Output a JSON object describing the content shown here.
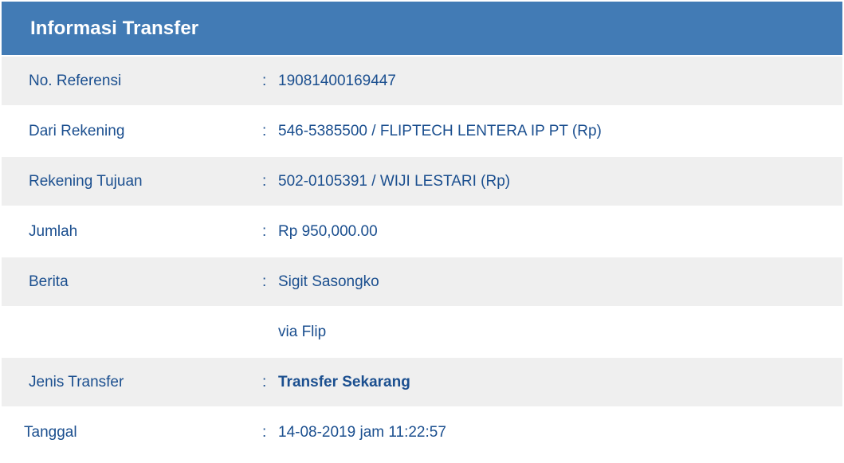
{
  "header": {
    "title": "Informasi Transfer"
  },
  "separator": ":",
  "rows": [
    {
      "label": "No. Referensi",
      "value": "19081400169447"
    },
    {
      "label": "Dari Rekening",
      "value": "546-5385500 / FLIPTECH LENTERA IP PT (Rp)"
    },
    {
      "label": "Rekening Tujuan",
      "value": "502-0105391 / WIJI LESTARI (Rp)"
    },
    {
      "label": "Jumlah",
      "value": "Rp 950,000.00"
    },
    {
      "label": "Berita",
      "value": "Sigit Sasongko"
    },
    {
      "label": "",
      "value": "via Flip"
    },
    {
      "label": "Jenis Transfer",
      "value": "Transfer Sekarang"
    },
    {
      "label": "Tanggal",
      "value": "14-08-2019 jam 11:22:57"
    }
  ],
  "colors": {
    "header_bg": "#427bb5",
    "header_text": "#ffffff",
    "row_shade": "#efefef",
    "text": "#1b4f8f"
  }
}
